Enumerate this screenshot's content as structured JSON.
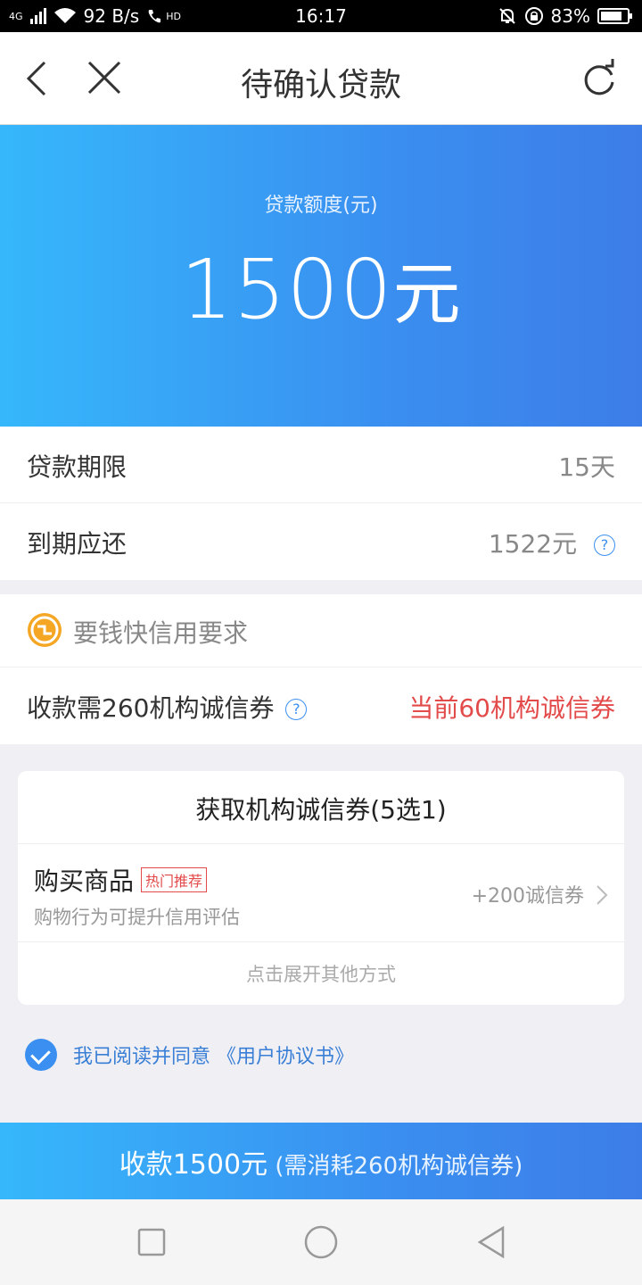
{
  "status_bar": {
    "network": "4G",
    "speed": "92 B/s",
    "hd": "HD",
    "time": "16:17",
    "battery": "83%",
    "battery_level": 0.83
  },
  "nav": {
    "title": "待确认贷款"
  },
  "hero": {
    "label": "贷款额度(元)",
    "amount": "1500",
    "unit": "元"
  },
  "loan_rows": [
    {
      "key": "贷款期限",
      "value": "15天"
    },
    {
      "key": "到期应还",
      "value": "1522元",
      "help": "?"
    }
  ],
  "requirements": {
    "title": "要钱快信用要求",
    "need_label": "收款需260机构诚信券",
    "help": "?",
    "current": "当前60机构诚信券"
  },
  "card": {
    "title": "获取机构诚信券(5选1)",
    "item": {
      "name": "购买商品",
      "tag": "热门推荐",
      "desc": "购物行为可提升信用评估",
      "reward": "+200诚信券"
    },
    "more": "点击展开其他方式"
  },
  "agreement": {
    "checked": true,
    "text": "我已阅读并同意 《用户协议书》"
  },
  "submit": {
    "main": "收款1500元",
    "sub": " (需消耗260机构诚信券)"
  },
  "colors": {
    "accent": "#3a8ff0",
    "gradient_start": "#36b7fb",
    "warning": "#e34a4a"
  }
}
